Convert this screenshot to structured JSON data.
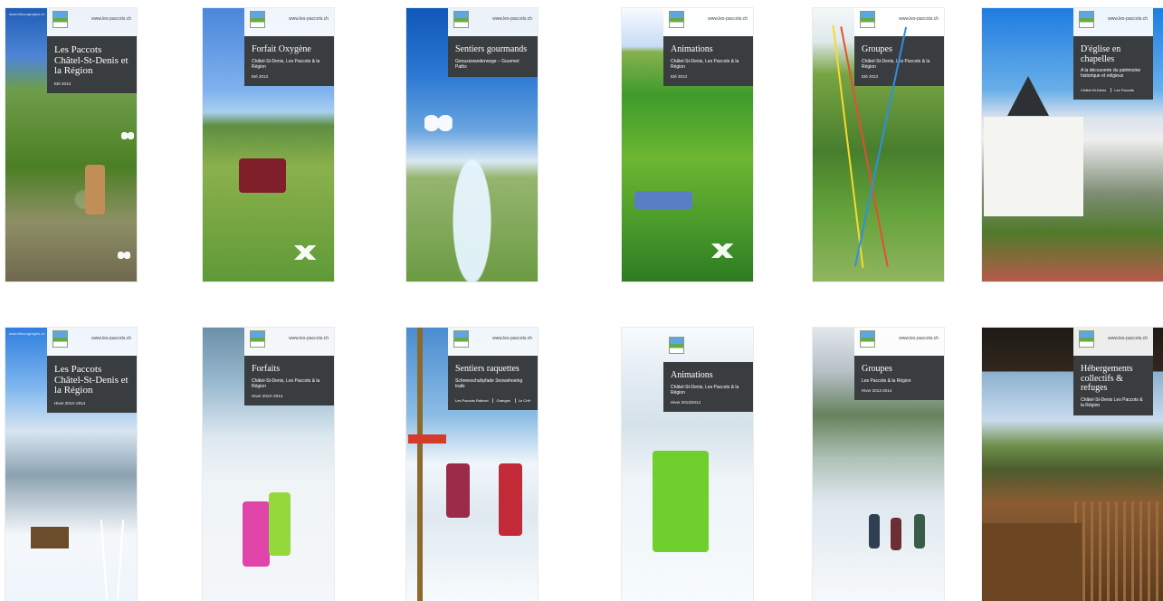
{
  "cards": {
    "r1c1": {
      "tag": "www.fribourgregion.ch",
      "site": "www.les-paccots.ch",
      "title": "Les Paccots Châtel-St-Denis et la Région",
      "season": "Eté 2013"
    },
    "r1c2": {
      "site": "www.les-paccots.ch",
      "title": "Forfait Oxygène",
      "subtitle": "Châtel-St-Denis, Les Paccots & la Région",
      "season": "Eté 2013"
    },
    "r1c3": {
      "site": "www.les-paccots.ch",
      "title": "Sentiers gourmands",
      "subtitle": "Genusswanderwege – Gourmet Paths"
    },
    "r1c4": {
      "site": "www.les-paccots.ch",
      "title": "Animations",
      "subtitle": "Châtel-St-Denis, Les Paccots & la Région",
      "season": "Eté 2013"
    },
    "r1c5": {
      "site": "www.les-paccots.ch",
      "title": "Groupes",
      "subtitle": "Châtel-St-Denis, Les Paccots & la Région",
      "season": "Eté 2013"
    },
    "r1c6": {
      "site": "www.les-paccots.ch",
      "title": "D'église en chapelles",
      "subtitle": "A la découverte du patrimoine historique et religieux",
      "meta_left": "Châtel-St-Denis",
      "meta_right": "Les Paccots"
    },
    "r2c1": {
      "tag": "www.fribourgregion.ch",
      "site": "www.les-paccots.ch",
      "title": "Les Paccots Châtel-St-Denis et la Région",
      "season": "Hiver 2013–2014"
    },
    "r2c2": {
      "site": "www.les-paccots.ch",
      "title": "Forfaits",
      "subtitle": "Châtel-St-Denis, Les Paccots & la Région",
      "season": "Hiver 2013–2014"
    },
    "r2c3": {
      "site": "www.les-paccots.ch",
      "title": "Sentiers raquettes",
      "subtitle": "Schneeschuhpfade Snowshoeing trails",
      "meta": [
        "Les Paccots Rathvel",
        "Granges",
        "Le Crêt"
      ]
    },
    "r2c4": {
      "title": "Animations",
      "subtitle": "Châtel-St-Denis, Les Paccots & la Région",
      "season": "Hiver 2013/2014"
    },
    "r2c5": {
      "site": "www.les-paccots.ch",
      "title": "Groupes",
      "subtitle": "Les Paccots & la Région",
      "season": "Hiver 2013-2014"
    },
    "r2c6": {
      "site": "www.les-paccots.ch",
      "title": "Hébergements collectifs & refuges",
      "subtitle": "Châtel-St-Denis Les Paccots & la Région"
    }
  }
}
